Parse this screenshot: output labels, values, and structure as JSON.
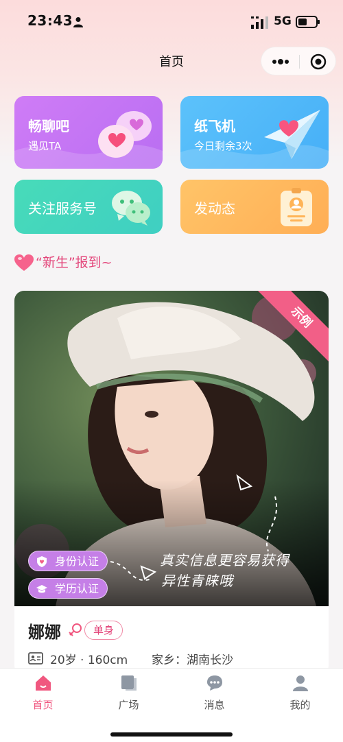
{
  "status_bar": {
    "time": "23:43",
    "network": "5G"
  },
  "nav": {
    "title": "首页"
  },
  "cards": {
    "chat": {
      "title": "畅聊吧",
      "subtitle": "遇见TA"
    },
    "plane": {
      "title": "纸飞机",
      "subtitle": "今日剩余3次"
    },
    "follow": {
      "title": "关注服务号"
    },
    "post": {
      "title": "发动态"
    }
  },
  "section": {
    "title": "“新生”报到~"
  },
  "profile": {
    "ribbon": "示例",
    "badges": {
      "identity": "身份认证",
      "education": "学历认证"
    },
    "caption_line1": "真实信息更容易获得",
    "caption_line2": "异性青睐哦",
    "name": "娜娜",
    "status_tag": "单身",
    "age_height": "20岁 · 160cm",
    "hometown": "家乡：湖南长沙"
  },
  "tabs": [
    {
      "label": "首页",
      "icon": "home-icon",
      "active": true
    },
    {
      "label": "广场",
      "icon": "square-icon",
      "active": false
    },
    {
      "label": "消息",
      "icon": "message-icon",
      "active": false
    },
    {
      "label": "我的",
      "icon": "profile-icon",
      "active": false
    }
  ],
  "colors": {
    "accent": "#f0577f",
    "chat": "#c97af6",
    "plane": "#52b9f9",
    "follow": "#44d6bd",
    "post": "#ffb85d"
  }
}
